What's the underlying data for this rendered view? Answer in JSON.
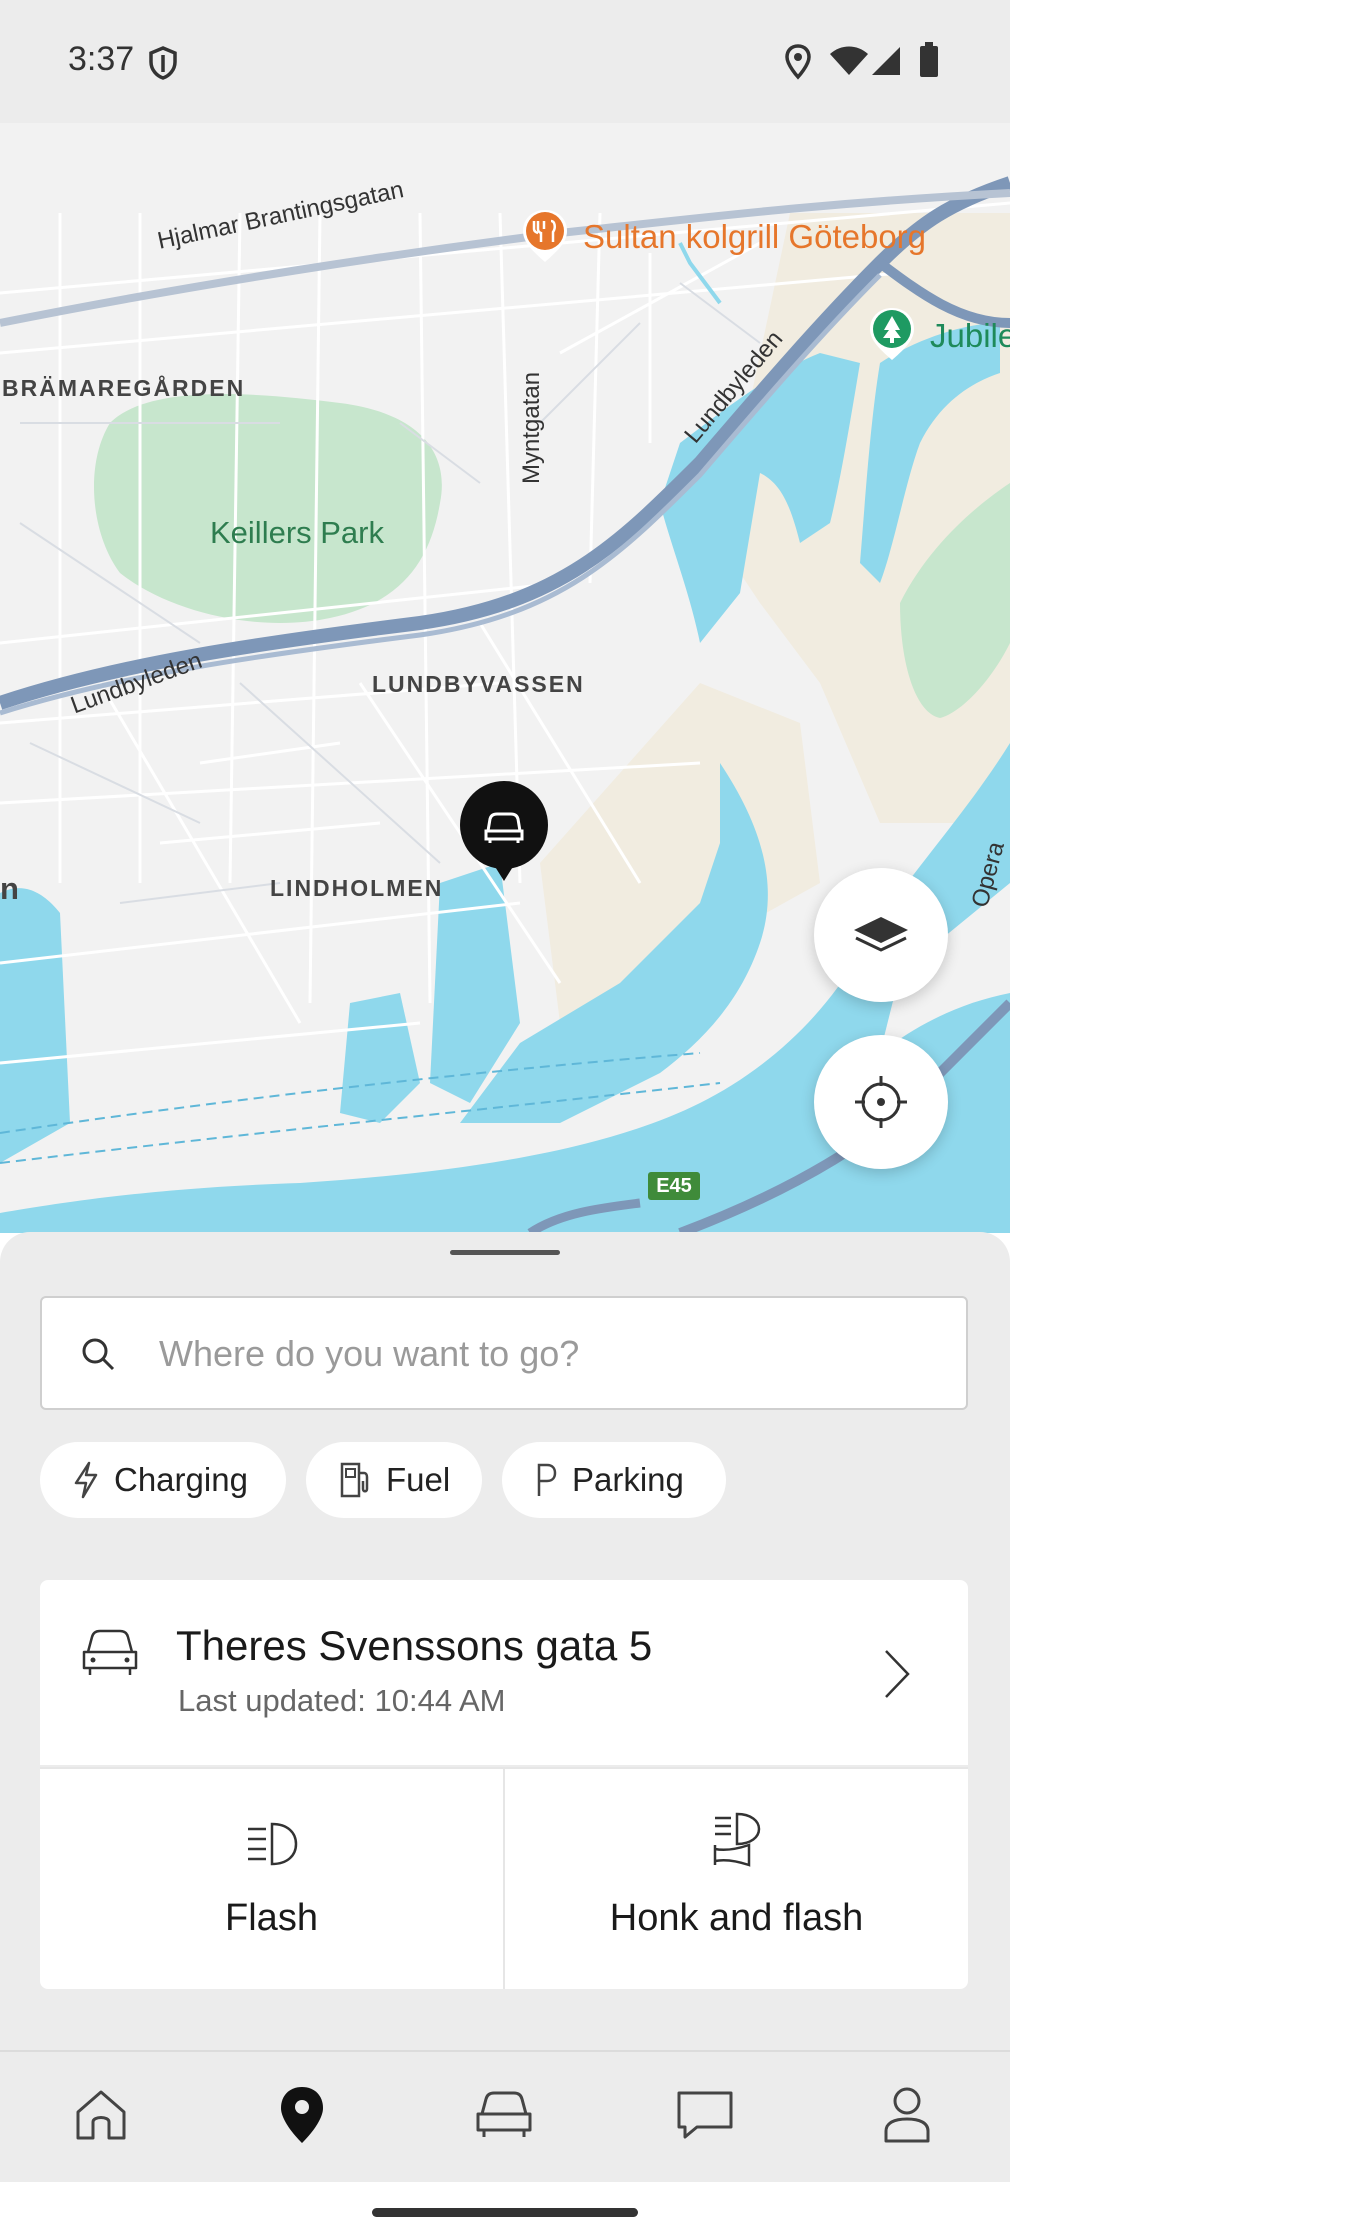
{
  "status_bar": {
    "time": "3:37"
  },
  "map": {
    "places": [
      {
        "name": "BRÄMAREGÅRDEN"
      },
      {
        "name": "LUNDBYVASSEN"
      },
      {
        "name": "LINDHOLMEN"
      },
      {
        "name": "n"
      }
    ],
    "park": "Keillers Park",
    "roads": [
      "Hjalmar Brantingsgatan",
      "Lundbyleden",
      "Lundbyleden",
      "Myntgatan",
      "Opera"
    ],
    "poi_restaurant": "Sultan kolgrill Göteborg",
    "poi_park": "Jubile",
    "highway_badge": "E45",
    "colors": {
      "water": "#8fd8ec",
      "park": "#c7e6cd",
      "road": "#7e97b8",
      "land": "#f2f2f2",
      "sand": "#f1ece0"
    }
  },
  "search": {
    "placeholder": "Where do you want to go?"
  },
  "filters": [
    {
      "label": "Charging",
      "icon": "bolt-icon"
    },
    {
      "label": "Fuel",
      "icon": "fuel-pump-icon"
    },
    {
      "label": "Parking",
      "icon": "parking-icon"
    }
  ],
  "vehicle_location": {
    "address": "Theres Svenssons gata 5",
    "last_updated": "Last updated: 10:44 AM"
  },
  "actions": [
    {
      "label": "Flash",
      "icon": "headlight-icon"
    },
    {
      "label": "Honk and flash",
      "icon": "honk-flash-icon"
    }
  ],
  "bottom_nav": [
    {
      "name": "home",
      "icon": "home-icon"
    },
    {
      "name": "map",
      "icon": "location-pin-icon",
      "active": true
    },
    {
      "name": "car",
      "icon": "car-icon"
    },
    {
      "name": "messages",
      "icon": "chat-icon"
    },
    {
      "name": "profile",
      "icon": "person-icon"
    }
  ]
}
